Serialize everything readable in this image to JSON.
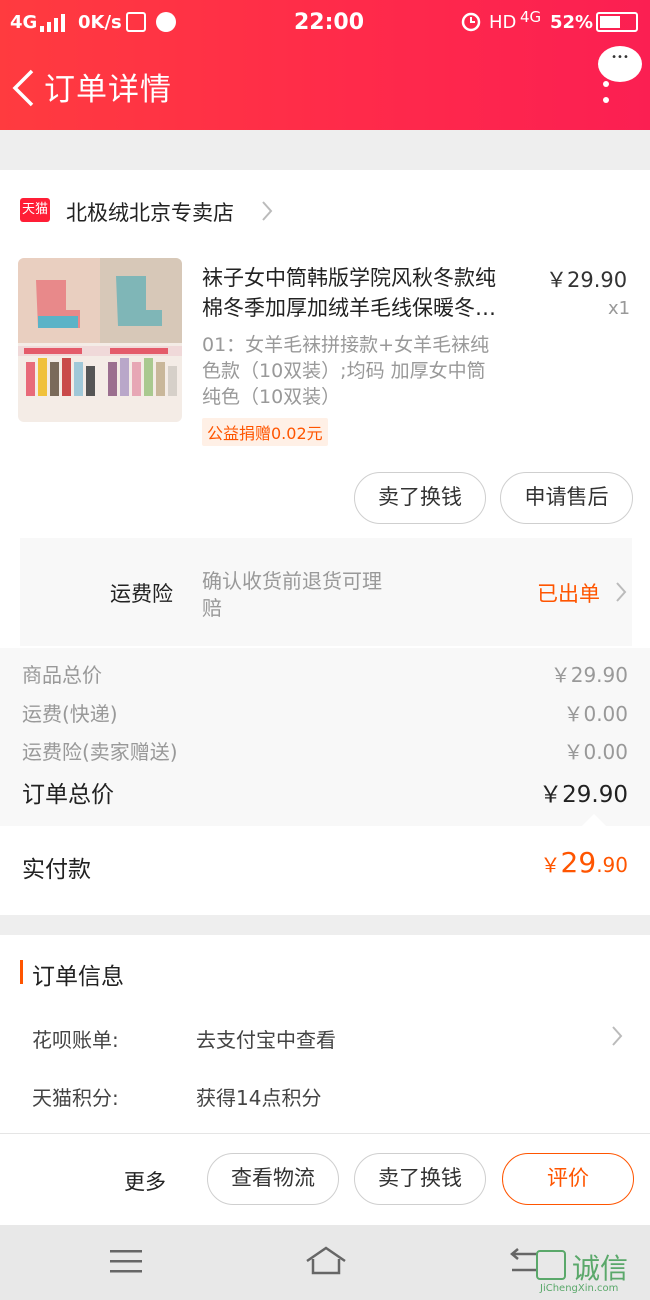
{
  "status_bar": {
    "signal": "4G",
    "speed": "0K/s",
    "time": "22:00",
    "network": "HD",
    "network_gen": "4G",
    "battery": "52%"
  },
  "header": {
    "title": "订单详情",
    "more_dots": "•••"
  },
  "store": {
    "badge": "天猫",
    "name": "北极绒北京专卖店"
  },
  "product": {
    "title_line1": "袜子女中筒韩版学院风秋冬款纯",
    "title_line2": "棉冬季加厚加绒羊毛线保暖冬…",
    "sku_line1": "01：女羊毛袜拼接款+女羊毛袜纯",
    "sku_line2": "色款（10双装）;均码 加厚女中筒",
    "sku_line3": "纯色（10双装）",
    "charity": "公益捐赠0.02元",
    "price": "￥29.90",
    "qty": "x1"
  },
  "item_actions": {
    "sell_label": "卖了换钱",
    "aftersale_label": "申请售后"
  },
  "insurance": {
    "label": "运费险",
    "desc_line1": "确认收货前退货可理",
    "desc_line2": "赔",
    "status": "已出单"
  },
  "summary": {
    "rows": [
      {
        "label": "商品总价",
        "value": "￥29.90"
      },
      {
        "label": "运费(快递)",
        "value": "￥0.00"
      },
      {
        "label": "运费险(卖家赠送)",
        "value": "￥0.00"
      }
    ],
    "total_label": "订单总价",
    "total_value": "￥29.90",
    "paid_label": "实付款",
    "paid_symbol": "￥",
    "paid_int": "29",
    "paid_dec": ".90"
  },
  "order_info": {
    "heading": "订单信息",
    "rows": [
      {
        "label": "花呗账单:",
        "value": "去支付宝中查看"
      },
      {
        "label": "天猫积分:",
        "value": "获得14点积分"
      }
    ]
  },
  "bottom_actions": {
    "more": "更多",
    "logistics": "查看物流",
    "sell": "卖了换钱",
    "review": "评价"
  },
  "watermark": {
    "cn": "诚信",
    "en": "JiChengXin.com"
  },
  "colors": {
    "brand_red": "#ff2a45",
    "accent_orange": "#ff5500",
    "charity_bg": "#fff0e6"
  }
}
